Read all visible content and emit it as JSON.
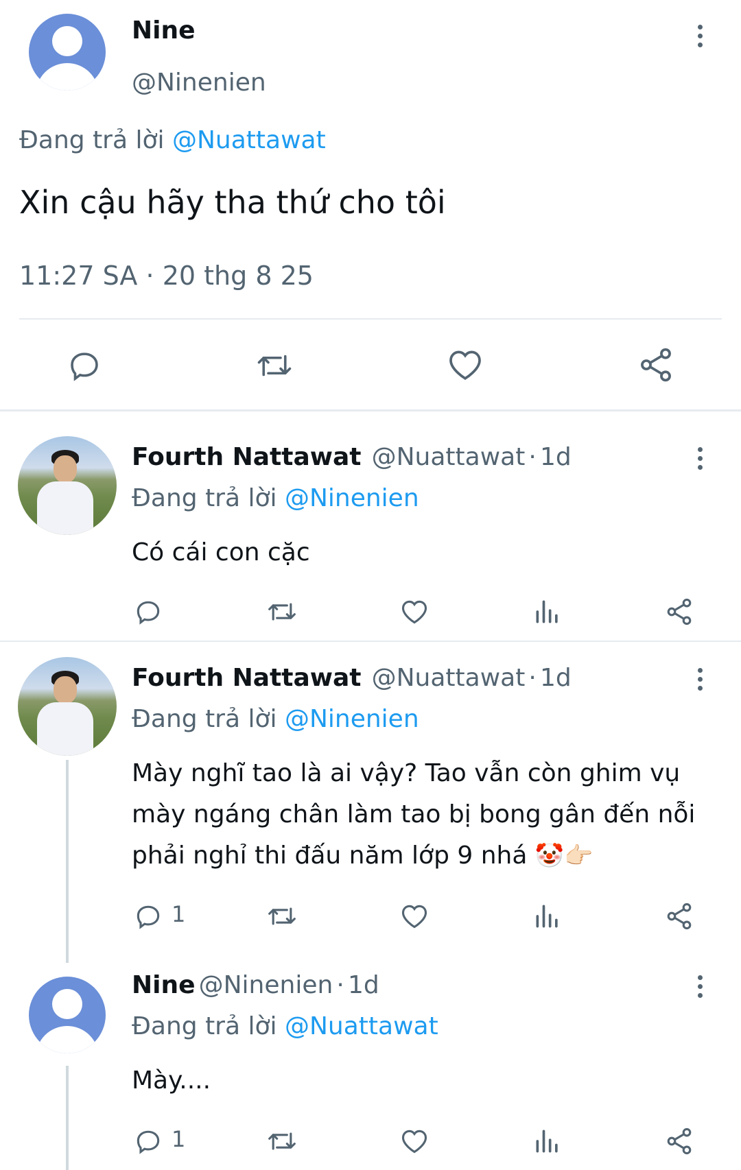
{
  "main_tweet": {
    "author_name": "Nine",
    "author_handle": "@Ninenien",
    "replying_prefix": "Đang trả lời ",
    "replying_to": "@Nuattawat",
    "text": "Xin cậu hãy tha thứ cho tôi",
    "time": "11:27 SA",
    "separator": "·",
    "date": "20 thg 8 25"
  },
  "replies": [
    {
      "author_name": "Fourth Nattawat",
      "author_handle": "@Nuattawat",
      "separator": "·",
      "age": "1d",
      "replying_prefix": "Đang trả lời ",
      "replying_to": "@Ninenien",
      "text": "Có cái con cặc",
      "reply_count": ""
    },
    {
      "author_name": "Fourth Nattawat",
      "author_handle": "@Nuattawat",
      "separator": "·",
      "age": "1d",
      "replying_prefix": "Đang trả lời ",
      "replying_to": "@Ninenien",
      "text_line1": "Mày nghĩ tao là ai vậy? Tao vẫn còn ghim vụ",
      "text_line2": "mày ngáng chân làm tao bị bong gân đến nỗi",
      "text_line3": "phải nghỉ thi đấu năm lớp 9 nhá",
      "emoji1": "🤡",
      "emoji2": "👉🏻",
      "reply_count": "1"
    },
    {
      "author_name": "Nine",
      "author_handle": "@Ninenien",
      "separator": "·",
      "age": "1d",
      "replying_prefix": "Đang trả lời ",
      "replying_to": "@Nuattawat",
      "text": "Mày....",
      "reply_count": "1"
    }
  ],
  "icons": {
    "reply": "reply-icon",
    "retweet": "retweet-icon",
    "like": "heart-icon",
    "views": "views-icon",
    "share": "share-icon",
    "more": "more-icon"
  },
  "colors": {
    "link": "#1d9bf0",
    "muted": "#536471",
    "text": "#0f1419",
    "divider": "#e6ebef"
  }
}
